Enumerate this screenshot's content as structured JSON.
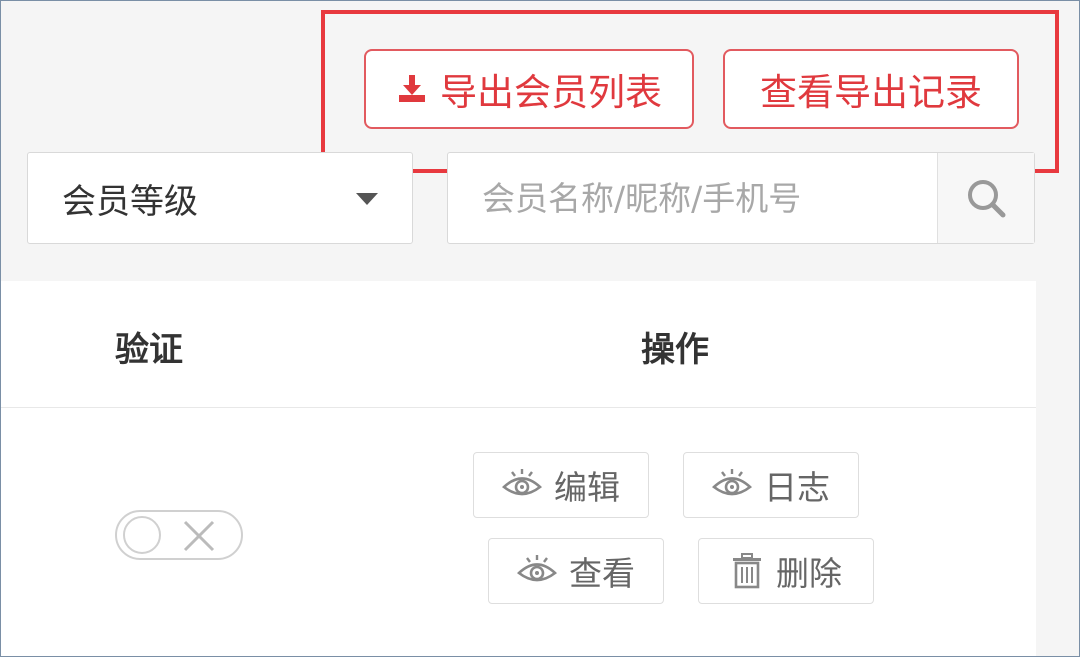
{
  "toolbar": {
    "export_label": "导出会员列表",
    "records_label": "查看导出记录",
    "accent_color": "#e8393f"
  },
  "filters": {
    "level_select_value": "会员等级",
    "search_placeholder": "会员名称/昵称/手机号"
  },
  "table": {
    "headers": [
      "验证",
      "操作"
    ],
    "rows": [
      {
        "verified": false,
        "actions": [
          "编辑",
          "日志",
          "查看",
          "删除"
        ]
      }
    ]
  },
  "icons": {
    "export": "download-icon",
    "search": "search-icon",
    "edit": "eye-icon",
    "log": "eye-icon",
    "view": "eye-icon",
    "delete": "trash-icon",
    "toggle_off": "x-icon"
  }
}
